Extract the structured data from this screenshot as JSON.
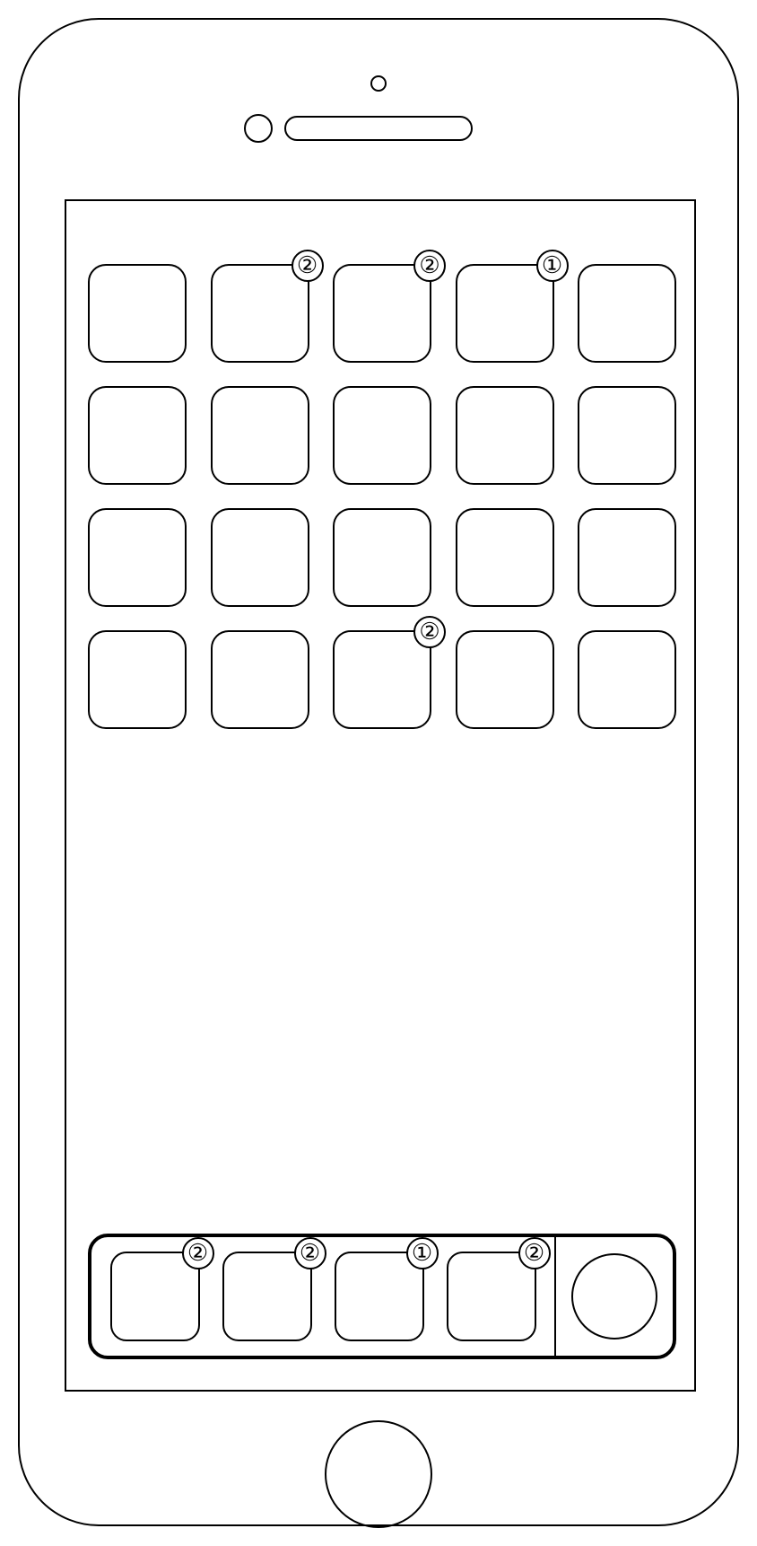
{
  "grid": {
    "rows": [
      {
        "icons": [
          {
            "badge": null
          },
          {
            "badge": "②"
          },
          {
            "badge": "②"
          },
          {
            "badge": "①"
          },
          {
            "badge": null
          }
        ]
      },
      {
        "icons": [
          {
            "badge": null
          },
          {
            "badge": null
          },
          {
            "badge": null
          },
          {
            "badge": null
          },
          {
            "badge": null
          }
        ]
      },
      {
        "icons": [
          {
            "badge": null
          },
          {
            "badge": null
          },
          {
            "badge": null
          },
          {
            "badge": null
          },
          {
            "badge": null
          }
        ]
      },
      {
        "icons": [
          {
            "badge": null
          },
          {
            "badge": null
          },
          {
            "badge": "②"
          },
          {
            "badge": null
          },
          {
            "badge": null
          }
        ]
      }
    ]
  },
  "dock": {
    "icons": [
      {
        "badge": "②"
      },
      {
        "badge": "②"
      },
      {
        "badge": "①"
      },
      {
        "badge": "②"
      }
    ]
  }
}
